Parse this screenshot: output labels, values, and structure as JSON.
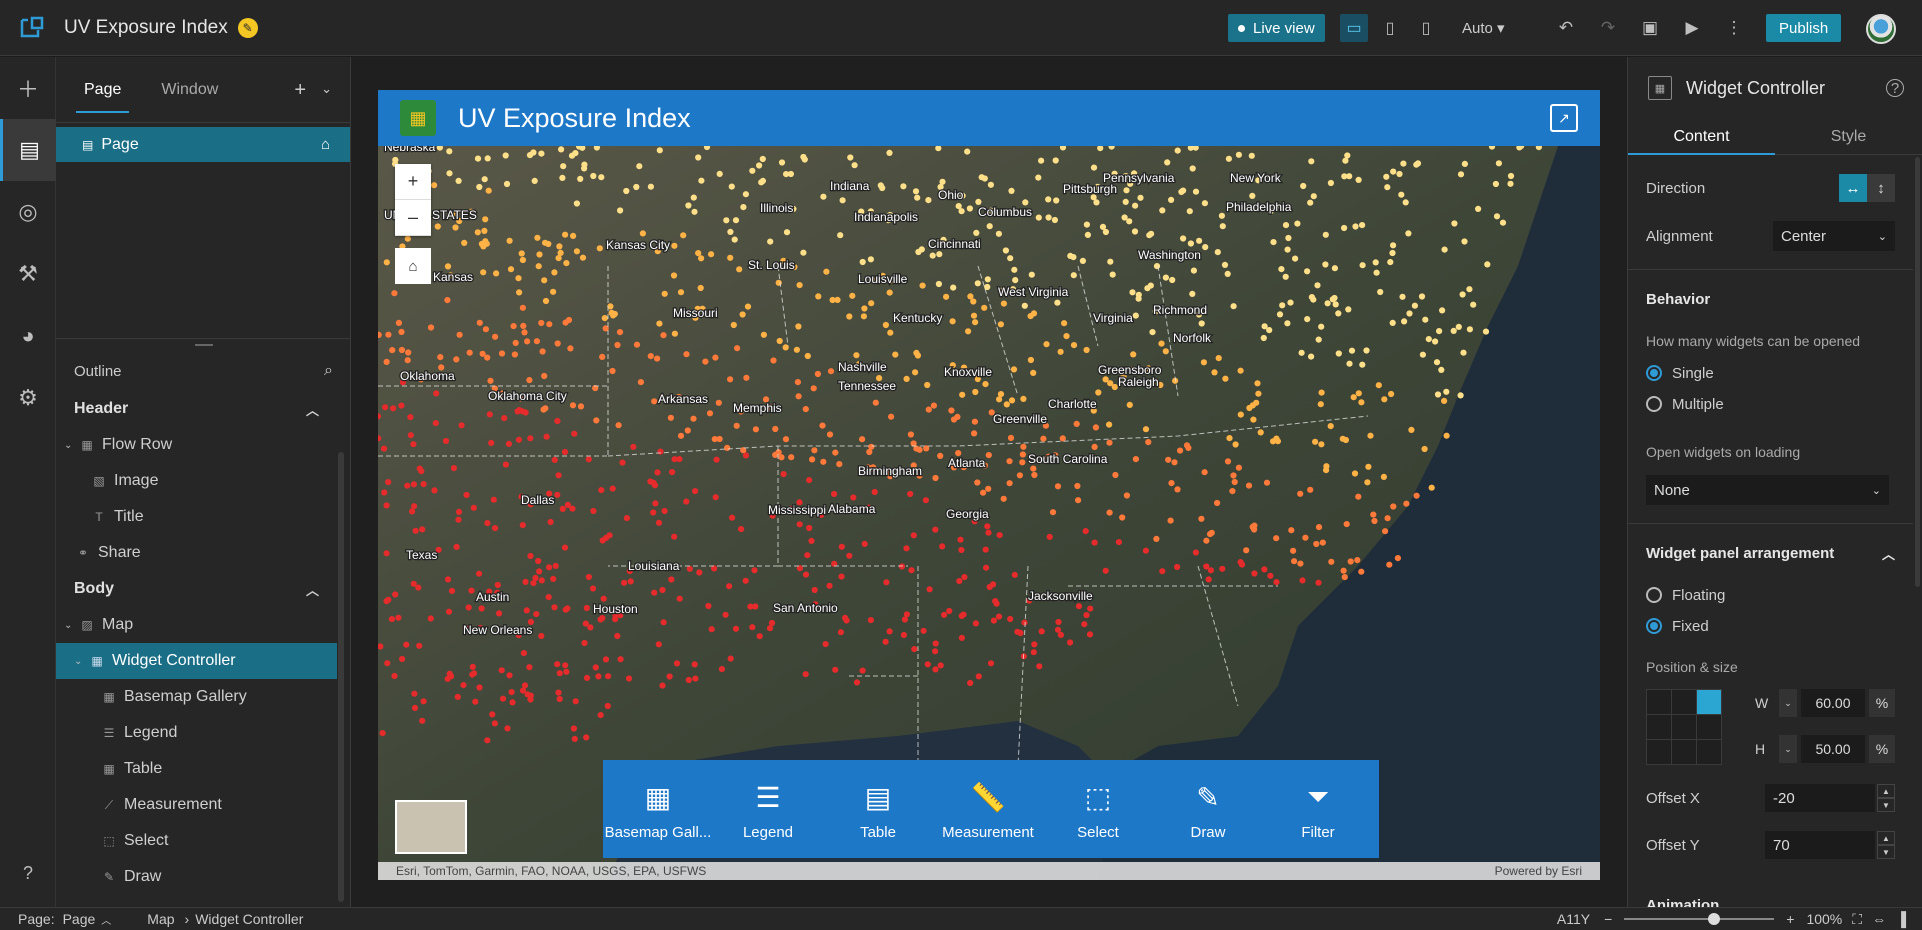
{
  "app": {
    "title": "UV Exposure Index"
  },
  "toolbar": {
    "live_view": "Live view",
    "auto": "Auto",
    "publish": "Publish",
    "device_icons": [
      "desktop-icon",
      "tablet-icon",
      "phone-icon"
    ],
    "action_icons": [
      "undo-icon",
      "redo-icon",
      "save-icon",
      "preview-icon",
      "more-icon"
    ]
  },
  "rail": {
    "items": [
      "add-icon",
      "page-icon",
      "data-icon",
      "widgets-icon",
      "theme-icon",
      "settings-icon"
    ],
    "help": "help-icon"
  },
  "left_panel": {
    "tabs": [
      "Page",
      "Window"
    ],
    "page_item": "Page",
    "outline_label": "Outline",
    "header_section": "Header",
    "body_section": "Body",
    "header_nodes": [
      "Flow Row",
      "Image",
      "Title",
      "Share"
    ],
    "body_nodes": [
      "Map",
      "Widget Controller",
      "Basemap Gallery",
      "Legend",
      "Table",
      "Measurement",
      "Select",
      "Draw"
    ]
  },
  "map_app": {
    "header_title": "UV Exposure Index",
    "attribution": "Esri, TomTom, Garmin, FAO, NOAA, USGS, EPA, USFWS",
    "powered_by": "Powered by Esri",
    "zoom_in": "+",
    "zoom_out": "–",
    "widgets": [
      "Basemap Gall...",
      "Legend",
      "Table",
      "Measurement",
      "Select",
      "Draw",
      "Filter"
    ],
    "place_labels": [
      "Indiana",
      "Ohio",
      "Pennsylvania",
      "New York",
      "Pittsburgh",
      "Philadelphia",
      "Columbus",
      "Indianapolis",
      "Illinois",
      "Kansas City",
      "St. Louis",
      "Cincinnati",
      "Washington",
      "Louisville",
      "West Virginia",
      "Missouri",
      "Kansas",
      "Kentucky",
      "Virginia",
      "Richmond",
      "Norfolk",
      "Nashville",
      "Knoxville",
      "Greensboro",
      "Raleigh",
      "Tennessee",
      "Oklahoma",
      "Oklahoma City",
      "Arkansas",
      "Memphis",
      "Charlotte",
      "Greenville",
      "Birmingham",
      "Atlanta",
      "South Carolina",
      "Dallas",
      "Mississippi",
      "Alabama",
      "Georgia",
      "Texas",
      "Louisiana",
      "Jacksonville",
      "Austin",
      "Houston",
      "New Orleans",
      "San Antonio",
      "UNITED STATES",
      "Nebraska"
    ]
  },
  "right_panel": {
    "title": "Widget Controller",
    "tabs": [
      "Content",
      "Style"
    ],
    "direction_label": "Direction",
    "alignment_label": "Alignment",
    "alignment_value": "Center",
    "behavior_label": "Behavior",
    "how_many_label": "How many widgets can be opened",
    "single": "Single",
    "multiple": "Multiple",
    "open_on_loading_label": "Open widgets on loading",
    "open_on_loading_value": "None",
    "arrangement_label": "Widget panel arrangement",
    "floating": "Floating",
    "fixed": "Fixed",
    "position_size_label": "Position & size",
    "w_label": "W",
    "h_label": "H",
    "w_value": "60.00",
    "h_value": "50.00",
    "unit": "%",
    "offset_x_label": "Offset X",
    "offset_x_value": "-20",
    "offset_y_label": "Offset Y",
    "offset_y_value": "70",
    "animation_label": "Animation"
  },
  "status_bar": {
    "page_label": "Page:",
    "page_value": "Page",
    "crumb_map": "Map",
    "crumb_widget": "Widget Controller",
    "a11y": "A11Y",
    "zoom": "100%",
    "zoom_fraction": 0.6
  },
  "colors": {
    "accent": "#1e78c8",
    "selection": "#1a6f87",
    "publish": "#1a8aa6"
  }
}
